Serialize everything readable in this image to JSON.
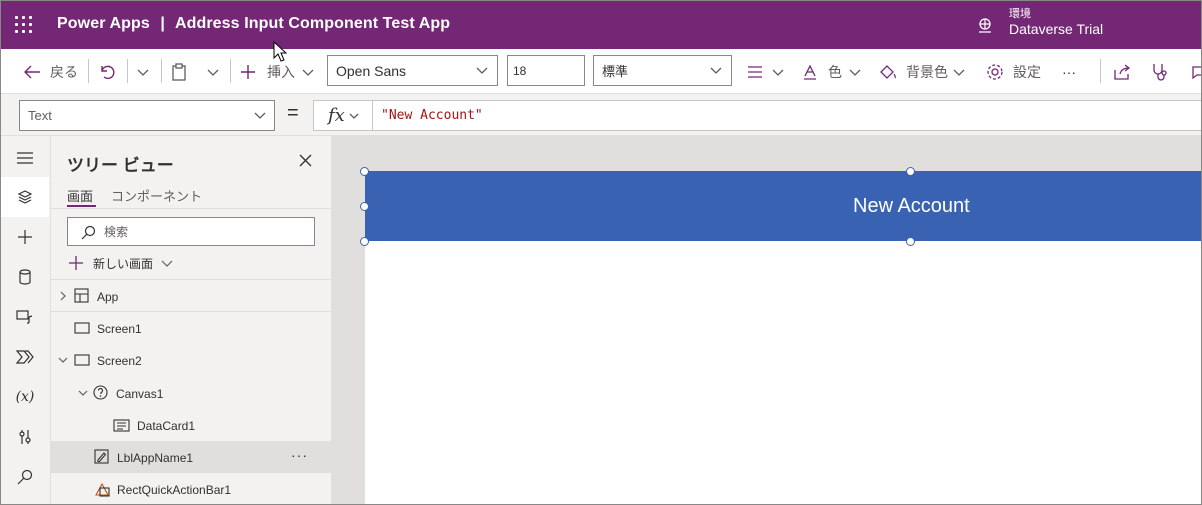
{
  "header": {
    "product": "Power Apps",
    "separator": "|",
    "app_name": "Address Input Component Test App",
    "env_label": "環境",
    "env_name": "Dataverse Trial",
    "brand_color": "#742774"
  },
  "command_bar": {
    "back_label": "戻る",
    "insert_label": "挿入",
    "font_family": "Open Sans",
    "font_size": "18",
    "font_weight": "標準",
    "color_label": "色",
    "fill_label": "背景色",
    "settings_label": "設定",
    "more_label": "···"
  },
  "formula_bar": {
    "property": "Text",
    "equals": "=",
    "fx_label": "fx",
    "formula": "\"New Account\""
  },
  "tree_view": {
    "title": "ツリー ビュー",
    "tabs": [
      {
        "label": "画面",
        "active": true
      },
      {
        "label": "コンポーネント",
        "active": false
      }
    ],
    "search_placeholder": "検索",
    "new_screen_label": "新しい画面",
    "nodes": [
      {
        "label": "App",
        "icon": "app-icon"
      },
      {
        "label": "Screen1",
        "icon": "screen-icon"
      },
      {
        "label": "Screen2",
        "icon": "screen-icon",
        "expanded": true
      },
      {
        "label": "Canvas1",
        "icon": "question-icon",
        "expanded": true
      },
      {
        "label": "DataCard1",
        "icon": "datacard-icon"
      },
      {
        "label": "LblAppName1",
        "icon": "label-edit-icon",
        "selected": true,
        "more": "···"
      },
      {
        "label": "RectQuickActionBar1",
        "icon": "shape-icon"
      }
    ]
  },
  "canvas": {
    "label_text": "New Account",
    "label_fill": "#3963b2"
  }
}
